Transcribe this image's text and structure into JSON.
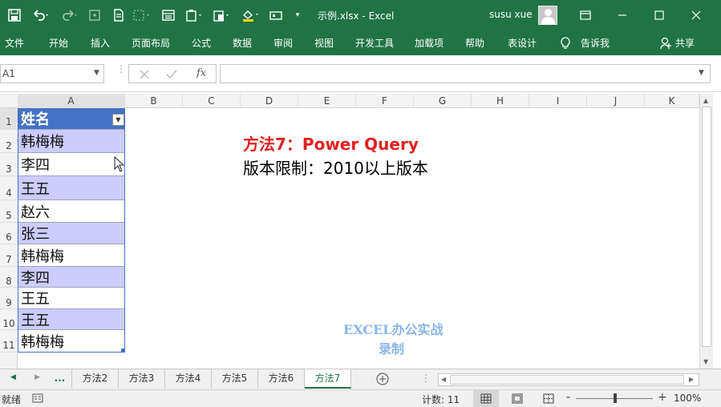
{
  "window": {
    "title": "示例.xlsx  -  Excel",
    "user": "susu xue"
  },
  "ribbon": {
    "tabs": [
      "文件",
      "开始",
      "插入",
      "页面布局",
      "公式",
      "数据",
      "审阅",
      "视图",
      "开发工具",
      "加载项",
      "帮助",
      "表设计"
    ],
    "tell_me": "告诉我",
    "share": "共享"
  },
  "formula_bar": {
    "name_box": "A1",
    "fx": "fx",
    "formula": ""
  },
  "grid": {
    "columns": [
      "A",
      "B",
      "C",
      "D",
      "E",
      "F",
      "G",
      "H",
      "I",
      "J",
      "K"
    ],
    "rows": [
      "1",
      "2",
      "3",
      "4",
      "5",
      "6",
      "7",
      "8",
      "9",
      "10",
      "11"
    ],
    "header": "姓名",
    "names": [
      "韩梅梅",
      "李四",
      "王五",
      "赵六",
      "张三",
      "韩梅梅",
      "李四",
      "王五",
      "王五",
      "韩梅梅"
    ]
  },
  "notes": {
    "method": "方法7：Power Query",
    "version": "版本限制：2010以上版本"
  },
  "watermark": {
    "line1": "EXCEL办公实战",
    "line2": "录制"
  },
  "sheets": {
    "ellipsis": "...",
    "tabs": [
      "方法2",
      "方法3",
      "方法4",
      "方法5",
      "方法6",
      "方法7"
    ],
    "active": "方法7"
  },
  "status": {
    "mode": "就绪",
    "count": "计数: 11",
    "zoom": "100%"
  },
  "colors": {
    "excel_green": "#217346",
    "table_header": "#4472c4",
    "band": "#ccccff",
    "note_red": "#e02020"
  }
}
